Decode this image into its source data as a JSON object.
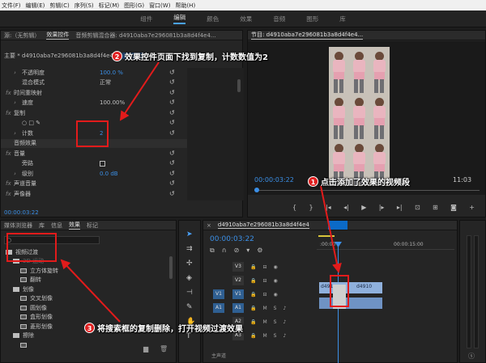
{
  "menubar": {
    "items": [
      "文件(F)",
      "编辑(E)",
      "剪辑(C)",
      "序列(S)",
      "标记(M)",
      "图形(G)",
      "窗口(W)",
      "帮助(H)"
    ]
  },
  "workspace": {
    "tabs": [
      "组件",
      "编辑",
      "颜色",
      "效果",
      "音频",
      "图形",
      "库"
    ],
    "active": "编辑"
  },
  "source_panel": {
    "tab1": "源:（无剪辑）",
    "tab2": "效果控件",
    "tab3": "音频剪辑混合器: d4910aba7e296081b3a8d4f4e4...",
    "menu": "≡"
  },
  "effect_controls": {
    "master_label": "主要 * d4910aba7e296081b3a8d4f4e4...",
    "master_chip": "d4910",
    "rows": [
      {
        "indent": 1,
        "prefix": "›",
        "label": "不透明度",
        "value": "100.0 %",
        "blue": true
      },
      {
        "indent": 1,
        "prefix": "",
        "label": "混合模式",
        "value": "正常",
        "blue": false
      },
      {
        "indent": 0,
        "prefix": "fx",
        "label": "时间重映射",
        "value": "",
        "blue": false
      },
      {
        "indent": 1,
        "prefix": "›",
        "label": "速度",
        "value": "100.00%",
        "blue": false
      },
      {
        "indent": 0,
        "prefix": "fx",
        "label": "复制",
        "value": "",
        "blue": false
      },
      {
        "indent": 1,
        "prefix": "",
        "label": "○ □ ✎",
        "value": "",
        "blue": false
      },
      {
        "indent": 1,
        "prefix": "›",
        "label": "计数",
        "value": "2",
        "blue": true
      },
      {
        "indent": 0,
        "prefix": "",
        "label": "音频效果",
        "value": "",
        "blue": false,
        "section": true
      },
      {
        "indent": 0,
        "prefix": "fx",
        "label": "音量",
        "value": "",
        "blue": false
      },
      {
        "indent": 1,
        "prefix": "",
        "label": "旁路",
        "value": "",
        "blue": false,
        "checkbox": true
      },
      {
        "indent": 1,
        "prefix": "›",
        "label": "级别",
        "value": "0.0 dB",
        "blue": true
      },
      {
        "indent": 0,
        "prefix": "fx",
        "label": "声道音量",
        "value": "",
        "blue": false
      },
      {
        "indent": 0,
        "prefix": "fx",
        "label": "声像器",
        "value": "",
        "blue": false
      }
    ],
    "timecode": "00:00:03:22"
  },
  "program": {
    "title": "节目: d4910aba7e296081b3a8d4f4e4...",
    "menu": "≡",
    "timecode": "00:00:03:22",
    "duration": "11:03",
    "zoom": "1/2"
  },
  "effects_panel": {
    "tabs": [
      "媒体浏览器",
      "库",
      "信息",
      "效果",
      "标记"
    ],
    "active": "效果",
    "search_placeholder": "",
    "tree": [
      {
        "level": 0,
        "label": "视频过渡",
        "folder": true
      },
      {
        "level": 1,
        "label": "3D 运动",
        "folder": true,
        "faded": true
      },
      {
        "level": 2,
        "label": "立方体旋转",
        "folder": false
      },
      {
        "level": 2,
        "label": "翻转",
        "folder": false
      },
      {
        "level": 1,
        "label": "划像",
        "folder": true
      },
      {
        "level": 2,
        "label": "交叉划像",
        "folder": false
      },
      {
        "level": 2,
        "label": "圆划像",
        "folder": false
      },
      {
        "level": 2,
        "label": "盒形划像",
        "folder": false
      },
      {
        "level": 2,
        "label": "菱形划像",
        "folder": false
      },
      {
        "level": 1,
        "label": "擦除",
        "folder": true
      },
      {
        "level": 2,
        "label": "",
        "folder": false
      }
    ]
  },
  "timeline": {
    "title": "d4910aba7e296081b3a8d4f4e4",
    "menu": "≡",
    "timecode": "00:00:03:22",
    "ruler_start": ":00:00",
    "ruler_mid": "00:00:15:00",
    "tracks": [
      {
        "src": "",
        "name": "V3",
        "type": "video"
      },
      {
        "src": "",
        "name": "V2",
        "type": "video"
      },
      {
        "src": "V1",
        "name": "V1",
        "type": "video"
      },
      {
        "src": "A1",
        "name": "A1",
        "type": "audio"
      },
      {
        "src": "",
        "name": "A2",
        "type": "audio"
      },
      {
        "src": "",
        "name": "A3",
        "type": "audio"
      }
    ],
    "master_label": "主声道",
    "clip_label": "d491",
    "clip_label2": "d4910"
  },
  "annotations": {
    "a1": {
      "num": "1",
      "text": "点击添加了效果的视频段"
    },
    "a2": {
      "num": "2",
      "text": "效果控件页面下找到复制，计数数值为2"
    },
    "a3": {
      "num": "3",
      "text": "将搜索框的复制删除，打开视频过渡效果"
    }
  },
  "colors": {
    "accent": "#3b8fe6",
    "annotation": "#e21b1b",
    "clip": "#7aa3d6"
  }
}
